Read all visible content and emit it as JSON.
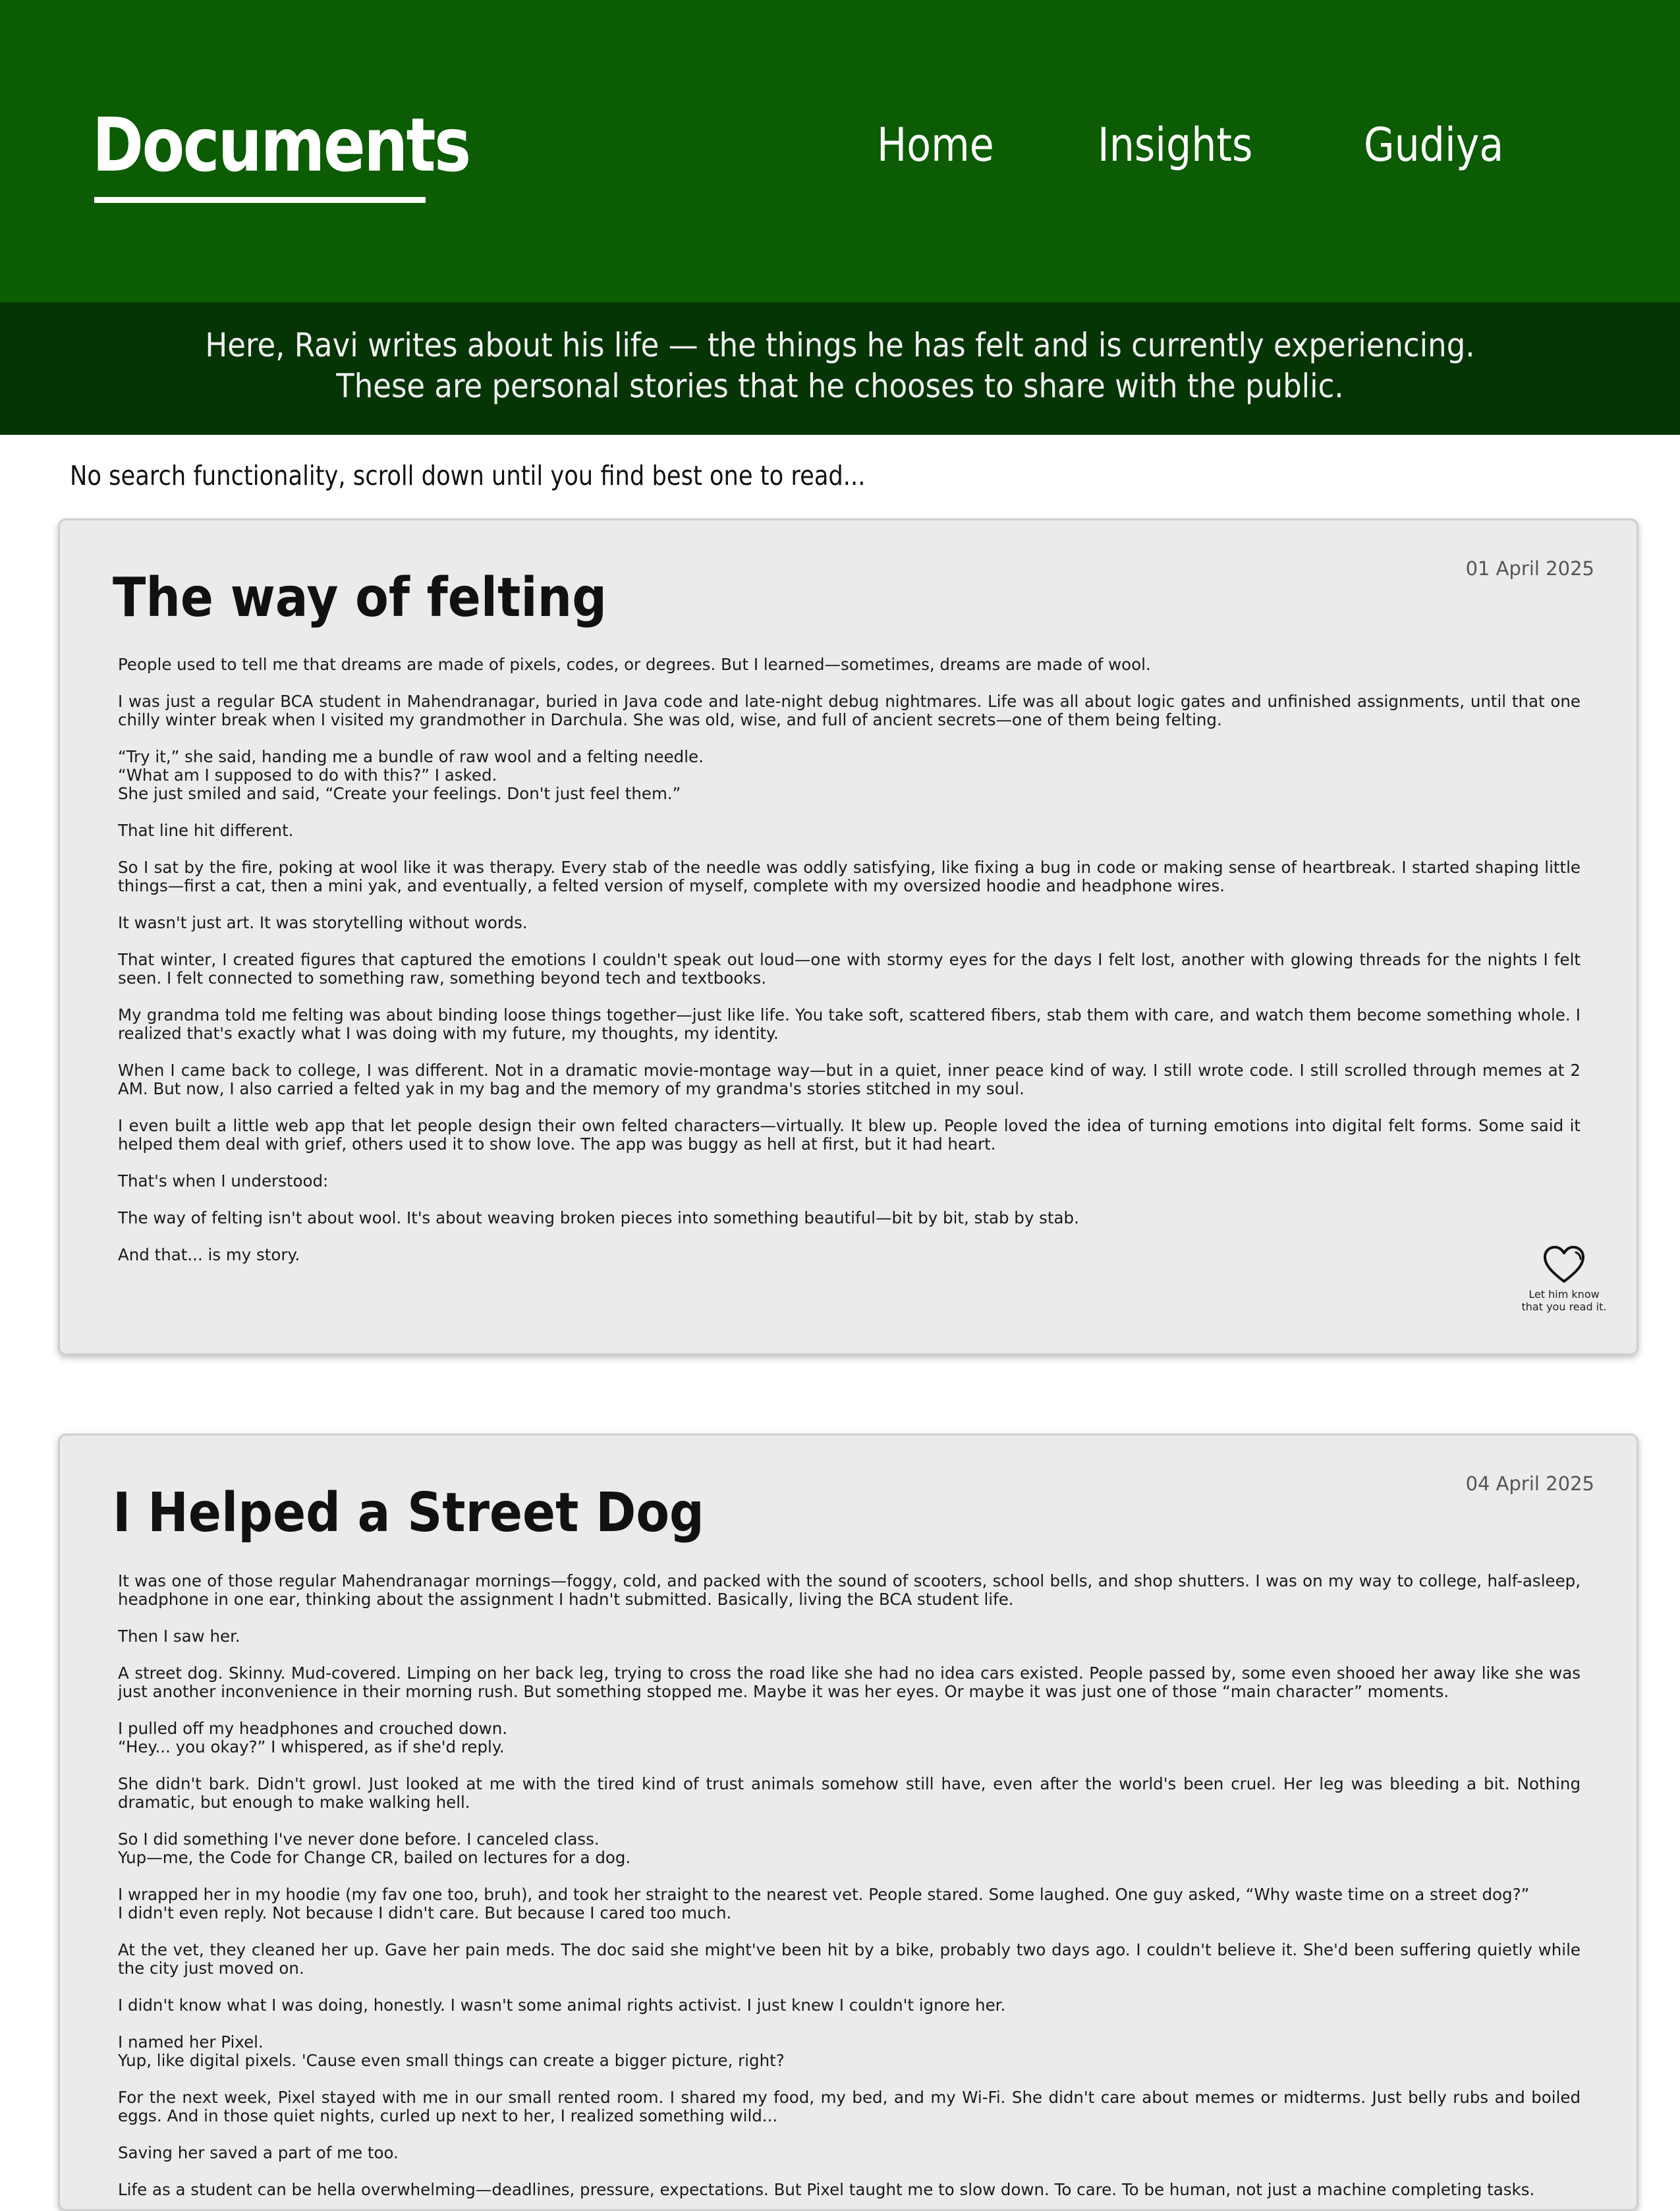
{
  "site": {
    "logo": "Documents",
    "nav": [
      "Home",
      "Insights",
      "Gudiya"
    ],
    "tagline": "Here, Ravi writes about his life — the things he has felt and is currently experiencing. These are personal stories that he chooses to share with the public.",
    "hint": "No search functionality, scroll down until you find best one to read...",
    "brand_color": "#0b5c02",
    "tagline_color": "#053504"
  },
  "posts": [
    {
      "date": "01 April 2025",
      "title": "The way of felting",
      "paragraphs": [
        "People used to tell me that dreams are made of pixels, codes, or degrees. But I learned—sometimes, dreams are made of wool.",
        "I was just a regular BCA student in Mahendranagar, buried in Java code and late-night debug nightmares. Life was all about logic gates and unfinished assignments, until that one chilly winter break when I visited my grandmother in Darchula. She was old, wise, and full of ancient secrets—one of them being felting.",
        "“Try it,” she said, handing me a bundle of raw wool and a felting needle.\n“What am I supposed to do with this?” I asked.\nShe just smiled and said, “Create your feelings. Don't just feel them.”",
        "That line hit different.",
        "So I sat by the fire, poking at wool like it was therapy. Every stab of the needle was oddly satisfying, like fixing a bug in code or making sense of heartbreak. I started shaping little things—first a cat, then a mini yak, and eventually, a felted version of myself, complete with my oversized hoodie and headphone wires.",
        "It wasn't just art. It was storytelling without words.",
        "That winter, I created figures that captured the emotions I couldn't speak out loud—one with stormy eyes for the days I felt lost, another with glowing threads for the nights I felt seen. I felt connected to something raw, something beyond tech and textbooks.",
        "My grandma told me felting was about binding loose things together—just like life. You take soft, scattered fibers, stab them with care, and watch them become something whole. I realized that's exactly what I was doing with my future, my thoughts, my identity.",
        "When I came back to college, I was different. Not in a dramatic movie-montage way—but in a quiet, inner peace kind of way. I still wrote code. I still scrolled through memes at 2 AM. But now, I also carried a felted yak in my bag and the memory of my grandma's stories stitched in my soul.",
        "I even built a little web app that let people design their own felted characters—virtually. It blew up. People loved the idea of turning emotions into digital felt forms. Some said it helped them deal with grief, others used it to show love. The app was buggy as hell at first, but it had heart.",
        "That's when I understood:",
        "The way of felting isn't about wool. It's about weaving broken pieces into something beautiful—bit by bit, stab by stab.",
        "And that... is my story."
      ],
      "like_label_1": "Let him know",
      "like_label_2": "that you read it."
    },
    {
      "date": "04 April 2025",
      "title": "I Helped a Street Dog",
      "paragraphs": [
        "It was one of those regular Mahendranagar mornings—foggy, cold, and packed with the sound of scooters, school bells, and shop shutters. I was on my way to college, half-asleep, headphone in one ear, thinking about the assignment I hadn't submitted. Basically, living the BCA student life.",
        "Then I saw her.",
        "A street dog. Skinny. Mud-covered. Limping on her back leg, trying to cross the road like she had no idea cars existed. People passed by, some even shooed her away like she was just another inconvenience in their morning rush. But something stopped me. Maybe it was her eyes. Or maybe it was just one of those “main character” moments.",
        "I pulled off my headphones and crouched down.\n“Hey... you okay?” I whispered, as if she'd reply.",
        "She didn't bark. Didn't growl. Just looked at me with the tired kind of trust animals somehow still have, even after the world's been cruel. Her leg was bleeding a bit. Nothing dramatic, but enough to make walking hell.",
        "So I did something I've never done before. I canceled class.\nYup—me, the Code for Change CR, bailed on lectures for a dog.",
        "I wrapped her in my hoodie (my fav one too, bruh), and took her straight to the nearest vet. People stared. Some laughed. One guy asked, “Why waste time on a street dog?”\nI didn't even reply. Not because I didn't care. But because I cared too much.",
        "At the vet, they cleaned her up. Gave her pain meds. The doc said she might've been hit by a bike, probably two days ago. I couldn't believe it. She'd been suffering quietly while the city just moved on.",
        "I didn't know what I was doing, honestly. I wasn't some animal rights activist. I just knew I couldn't ignore her.",
        "I named her Pixel.\nYup, like digital pixels. 'Cause even small things can create a bigger picture, right?",
        "For the next week, Pixel stayed with me in our small rented room. I shared my food, my bed, and my Wi-Fi. She didn't care about memes or midterms. Just belly rubs and boiled eggs. And in those quiet nights, curled up next to her, I realized something wild...",
        "Saving her saved a part of me too.",
        "Life as a student can be hella overwhelming—deadlines, pressure, expectations. But Pixel taught me to slow down. To care. To be human, not just a machine completing tasks."
      ]
    }
  ]
}
